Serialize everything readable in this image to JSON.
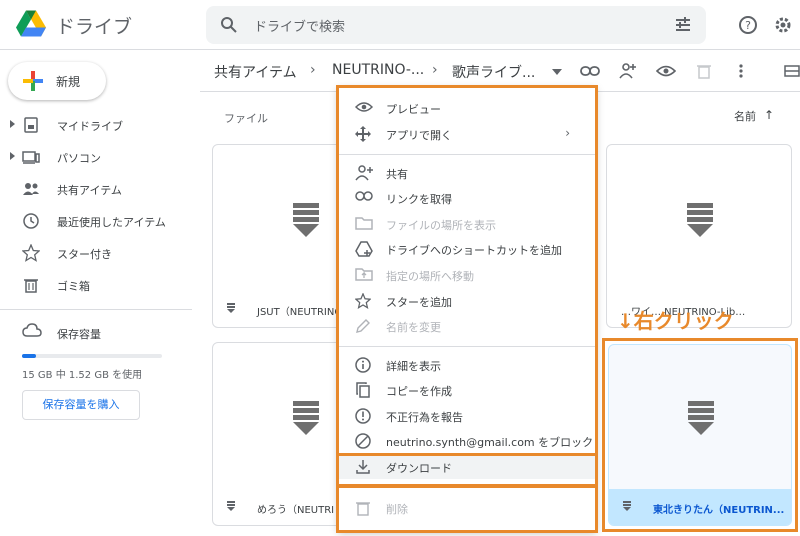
{
  "header": {
    "app_title": "ドライブ",
    "search_placeholder": "ドライブで検索"
  },
  "sidebar": {
    "new_label": "新規",
    "items": [
      {
        "label": "マイドライブ",
        "icon": "my-drive-icon"
      },
      {
        "label": "パソコン",
        "icon": "computer-icon"
      },
      {
        "label": "共有アイテム",
        "icon": "shared-icon"
      },
      {
        "label": "最近使用したアイテム",
        "icon": "clock-icon"
      },
      {
        "label": "スター付き",
        "icon": "star-icon"
      },
      {
        "label": "ゴミ箱",
        "icon": "trash-icon"
      }
    ],
    "storage_label": "保存容量",
    "storage_usage": "15 GB 中 1.52 GB を使用",
    "storage_fraction": 0.1,
    "buy_label": "保存容量を購入"
  },
  "breadcrumb": {
    "items": [
      "共有アイテム",
      "NEUTRINO-...",
      "歌声ライブ..."
    ]
  },
  "list": {
    "column_files": "ファイル",
    "column_name": "名前",
    "sort_arrow": "↑"
  },
  "cards": [
    {
      "name": "JSUT（NEUTRINO"
    },
    {
      "name": "…ワイ… NEUTRINO-Lib…"
    },
    {
      "name": "めろう（NEUTRI"
    },
    {
      "name": "東北きりたん（NEUTRIN..."
    }
  ],
  "context_menu": {
    "items": [
      {
        "label": "プレビュー",
        "icon": "eye-icon",
        "disabled": false
      },
      {
        "label": "アプリで開く",
        "icon": "move-icon",
        "disabled": false,
        "submenu": "›"
      },
      {
        "label": "共有",
        "icon": "add-person-icon",
        "disabled": false
      },
      {
        "label": "リンクを取得",
        "icon": "link-icon",
        "disabled": false
      },
      {
        "label": "ファイルの場所を表示",
        "icon": "folder-icon",
        "disabled": true
      },
      {
        "label": "ドライブへのショートカットを追加",
        "icon": "shortcut-icon",
        "disabled": false
      },
      {
        "label": "指定の場所へ移動",
        "icon": "move-folder-icon",
        "disabled": true
      },
      {
        "label": "スターを追加",
        "icon": "star-icon",
        "disabled": false
      },
      {
        "label": "名前を変更",
        "icon": "pencil-icon",
        "disabled": true
      },
      {
        "label": "詳細を表示",
        "icon": "info-icon",
        "disabled": false
      },
      {
        "label": "コピーを作成",
        "icon": "copy-icon",
        "disabled": false
      },
      {
        "label": "不正行為を報告",
        "icon": "report-icon",
        "disabled": false
      },
      {
        "label": "neutrino.synth@gmail.com をブロック",
        "icon": "block-icon",
        "disabled": false
      },
      {
        "label": "ダウンロード",
        "icon": "download-icon",
        "disabled": false,
        "highlighted": true
      },
      {
        "label": "削除",
        "icon": "trash-icon",
        "disabled": true
      }
    ]
  },
  "annotation": "↓右クリック",
  "colors": {
    "accent": "#1a73e8",
    "highlight_outline": "#e8892b",
    "selected_card": "#c2e7ff"
  }
}
